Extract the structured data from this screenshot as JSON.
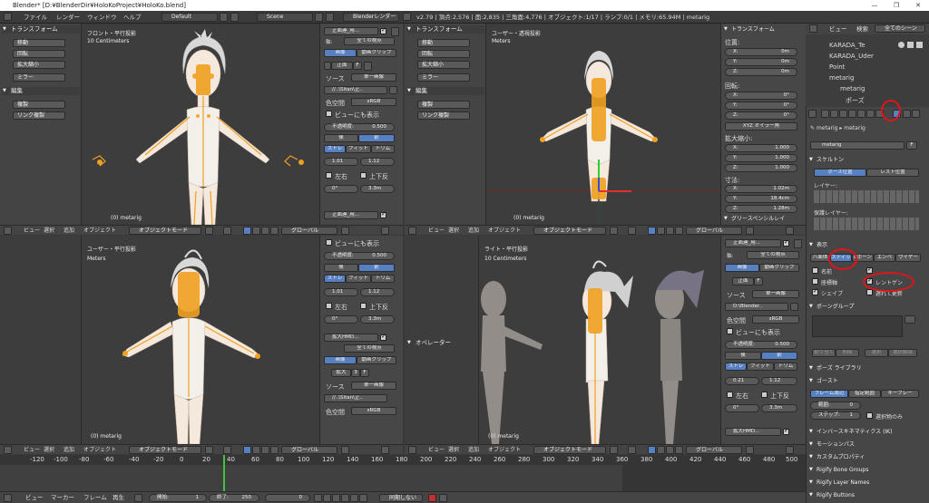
{
  "window": {
    "title": "Blender* [D:¥BlenderDir¥HoloKoProject¥HoloKo.blend]",
    "minimize": "—",
    "maximize": "❐",
    "close": "✕"
  },
  "menu": {
    "items": [
      "ファイル",
      "レンダー",
      "ウィンドウ",
      "ヘルプ"
    ],
    "layout": "Default",
    "scene": "Scene",
    "engine": "Blenderレンダー",
    "stats": "v2.79 | 頂点:2,576 | 面:2,835 | 三角面:4,776 | オブジェクト:1/17 | ランプ:0/1 | メモリ:65.94M | metarig"
  },
  "toolshelf": {
    "transform_title": "トランスフォーム",
    "transform_btns": [
      "移動",
      "回転",
      "拡大縮小",
      "ミラー"
    ],
    "edit_title": "編集",
    "edit_btns": [
      "複製",
      "リンク複製"
    ]
  },
  "viewports": {
    "tl": {
      "name": "フロント・平行投影",
      "units": "10 Centimeters",
      "foot": "(0) metarig"
    },
    "tr": {
      "name": "ユーザー・透視投影",
      "units": "Meters",
      "foot": "(0) metarig"
    },
    "bl": {
      "name": "ユーザー・平行投影",
      "units": "Meters",
      "foot": "(0) metarig"
    },
    "br": {
      "name": "ライト・平行投影",
      "units": "10 Centimeters",
      "foot": "(0) metarig"
    }
  },
  "header": {
    "view": "ビュー",
    "select": "選択",
    "add": "追加",
    "object": "オブジェクト",
    "mode": "オブジェクトモード",
    "pivot": "グローバル"
  },
  "bgimg": {
    "tl": {
      "title": "正面連_用...",
      "view": "全ての視点",
      "image": "画像",
      "movie": "動画クリップ",
      "frontlabel": "正面",
      "f": "F",
      "source": "ソース",
      "source_val": "単一画像",
      "file": "//..\\Sitan\\正..",
      "colorspace": "色空間",
      "colorspace_val": "sRGB",
      "show_all": "ビューにも表示",
      "opacity": "不透明度:",
      "opacity_val": "0.500",
      "back": "後",
      "front": "前",
      "stretch": "ストレ",
      "fit": "フィット",
      "crop": "トリム",
      "sx": "1.01",
      "sy": "1.12",
      "lr": "左右",
      "ud": "上下反",
      "rot": "0°",
      "size": "3.3m"
    },
    "bl": {
      "title": "正面連_用...",
      "view": "全ての視点",
      "show_all": "ビューにも表示",
      "opacity": "不透明度:",
      "opacity_val": "0.500",
      "back": "後",
      "front": "前",
      "stretch": "ストレ",
      "fit": "フィット",
      "crop": "トリム",
      "sx": "1.01",
      "sy": "1.12",
      "lr": "左右",
      "ud": "上下反",
      "rot": "0°",
      "size": "3.3m",
      "title2": "拡大HMD...",
      "view2": "全ての視点",
      "image": "画像",
      "movie": "動画クリップ",
      "zoom": "拡大",
      "three": "3",
      "f": "F",
      "source": "ソース",
      "source_val": "単一画像",
      "file": "//..\\Sitan\\正..",
      "colorspace": "色空間",
      "colorspace_val": "sRGB"
    },
    "br": {
      "title": "正面連_用...",
      "view": "全ての視点",
      "image": "画像",
      "movie": "動画クリップ",
      "frontlabel": "正面",
      "f": "F",
      "source": "ソース",
      "source_val": "単一画像",
      "file": "D:\\Blender..",
      "colorspace": "色空間",
      "colorspace_val": "sRGB",
      "show_all": "ビューにも表示",
      "opacity": "不透明度:",
      "opacity_val": "0.500",
      "back": "後",
      "front": "前",
      "stretch": "ストレ",
      "fit": "フィット",
      "crop": "トリム",
      "sx": "0.21",
      "sy": "1.12",
      "lr": "左右",
      "ud": "上下反",
      "rot": "0°",
      "size": "3.3m",
      "title2": "拡大HMD..."
    }
  },
  "transform_panel": {
    "title": "トランスフォーム",
    "location": "位置:",
    "loc": [
      "0m",
      "0m",
      "0m"
    ],
    "rotation": "回転:",
    "rot": [
      "0°",
      "0°",
      "0°"
    ],
    "mode": "XYZ オイラー角",
    "scale": "拡大縮小:",
    "scl": [
      "1.000",
      "1.000",
      "1.000"
    ],
    "dimensions": "寸法:",
    "dim": [
      "1.02m",
      "18.4cm",
      "1.28m"
    ],
    "axes": [
      "X:",
      "Y:",
      "Z:"
    ],
    "grease": "グリースペンシルレイ"
  },
  "operator": "オペレーター",
  "outliner": {
    "view": "ビュー",
    "search": "検索",
    "scenes": "全てのシーン",
    "items": [
      "KARADA_Te",
      "KARADA_Uder",
      "Point",
      "metarig",
      "metarig",
      "ポーズ"
    ]
  },
  "properties": {
    "crumb1": "metarig",
    "crumb2": "metarig",
    "name": "metarig",
    "f": "F",
    "skeleton": "スケルトン",
    "pose_pos": "ポーズ位置",
    "rest_pos": "レスト位置",
    "layers": "レイヤー:",
    "protected": "保護レイヤー:",
    "display": "表示",
    "disp_tabs": [
      "八面体",
      "スティック",
      "Bボーン",
      "エンベ",
      "ワイヤー"
    ],
    "names": "名前",
    "axes": "座標軸",
    "shape": "シェイプ",
    "xray": "レントゲン",
    "delay": "遅れて更新",
    "bone_groups": "ボーングループ",
    "bg_btns": [
      "割り当て",
      "削除",
      "選択",
      "選択解除"
    ],
    "pose_library": "ポーズ ライブラリ",
    "ghost": "ゴースト",
    "ghost_tabs": [
      "フレーム周辺",
      "指定範囲",
      "キーフレー"
    ],
    "range": "範囲:",
    "range_val": "0",
    "step": "ステップ:",
    "step_val": "1",
    "sel_only": "選択物のみ",
    "ik": "インバースキネマティクス (IK)",
    "motion": "モーションパス",
    "custom": "カスタムプロパティ",
    "rig_groups": "Rigify Bone Groups",
    "rig_layers": "Rigify Layer Names",
    "rig_buttons": "Rigify Buttons"
  },
  "timeline": {
    "ticks": [
      "-120",
      "-100",
      "-80",
      "-60",
      "-40",
      "-20",
      "0",
      "20",
      "40",
      "60",
      "80",
      "100",
      "120",
      "140",
      "160",
      "180",
      "200",
      "220",
      "240",
      "260",
      "280",
      "300",
      "320",
      "340",
      "360",
      "380",
      "400",
      "420",
      "440",
      "460",
      "480",
      "500",
      "520"
    ],
    "view": "ビュー",
    "marker": "マーカー",
    "frame": "フレーム",
    "play": "再生",
    "start": "開始:",
    "start_val": "1",
    "end": "終了:",
    "end_val": "250",
    "cur": "0",
    "sync": "同期しない"
  },
  "colors": {
    "accent": "#5680c2",
    "highlight": "#e0141a",
    "bone": "#f0a020"
  }
}
